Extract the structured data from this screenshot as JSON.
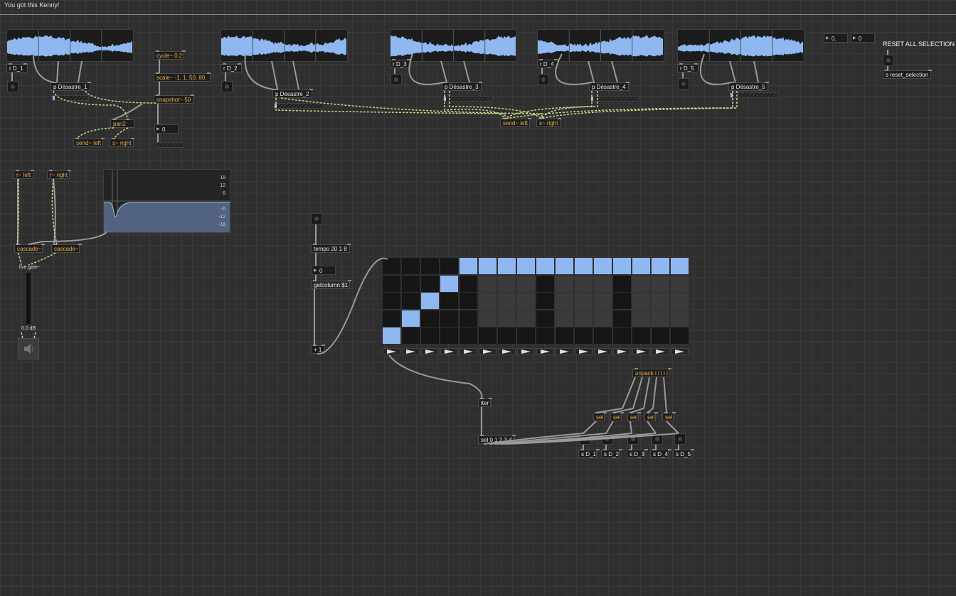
{
  "title": "You got this Kenny!",
  "reset_label": "RESET ALL SELECTION",
  "colors": {
    "wave": "#8fb7f0",
    "keyword": "#f0a84a",
    "cell_on": "#8fb7f0",
    "patch_bg": "#2f2f2f"
  },
  "numbers": {
    "top_float": "0.",
    "top_int": "0",
    "snap_out": "0",
    "tempo_out": "0",
    "gain_db": "0.0 dB"
  },
  "objects": {
    "r_d1": "r D_1",
    "r_d2": "r D_2",
    "r_d3": "r D_3",
    "r_d4": "r D_4",
    "r_d5": "r D_5",
    "p1": "p Désastre_1",
    "p2": "p Désastre_2",
    "p3": "p Désastre_3",
    "p4": "p Désastre_4",
    "p5": "p Désastre_5",
    "cycle": "cycle~ 0.2",
    "scale": "scale~ -1. 1. 50. 80.",
    "snapshot": "snapshot~ 50",
    "pan2": "pan2",
    "send_left_a": "send~ left",
    "s_right_a": "s~ right",
    "send_left_b": "send~ left",
    "s_right_b": "s~ right",
    "s_reset": "s reset_selection",
    "r_left": "r~ left",
    "r_right": "r~ right",
    "cascade_l": "cascade~",
    "cascade_r": "cascade~",
    "live_gain": "live.gain~",
    "tempo": "tempo 20 1 8",
    "getcolumn": "getcolumn $1",
    "plus1": "+ 1",
    "iter": "iter",
    "sel_main": "sel 0 1 2 3 4",
    "unpack": "unpack i i i i i",
    "sel": "sel",
    "s_d1": "s D_1",
    "s_d2": "s D_2",
    "s_d3": "s D_3",
    "s_d4": "s D_4",
    "s_d5": "s D_5"
  },
  "eq_labels": [
    "18",
    "12",
    "6",
    "-6",
    "-12",
    "-18"
  ],
  "sequencer": {
    "columns": 16,
    "rows": 5,
    "active": [
      [
        0,
        4,
        0
      ],
      [
        0,
        5,
        0
      ],
      [
        0,
        6,
        0
      ],
      [
        0,
        7,
        0
      ],
      [
        0,
        8,
        0
      ],
      [
        0,
        9,
        0
      ],
      [
        0,
        10,
        0
      ],
      [
        0,
        11,
        0
      ],
      [
        0,
        12,
        0
      ],
      [
        0,
        13,
        0
      ],
      [
        0,
        14,
        0
      ],
      [
        0,
        15,
        0
      ],
      [
        1,
        3,
        0
      ],
      [
        2,
        2,
        0
      ],
      [
        3,
        1,
        0
      ],
      [
        4,
        0,
        0
      ]
    ]
  }
}
